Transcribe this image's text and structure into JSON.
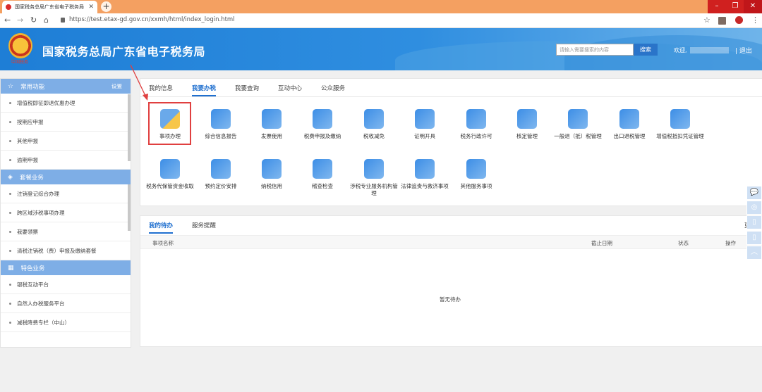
{
  "browser": {
    "tab_title": "国家税务总局广东省电子税务局",
    "url": "https://test.etax-gd.gov.cn/xxmh/html/index_login.html"
  },
  "header": {
    "title": "国家税务总局广东省电子税务局",
    "emblem_caption": "中国税务",
    "search_placeholder": "请输入需要搜索的内容",
    "search_button": "搜索",
    "welcome": "欢迎,",
    "logout": "| 退出"
  },
  "sidebar": {
    "sections": [
      {
        "title": "常用功能",
        "settings": "设置",
        "items": [
          "增值税即征即退优惠办理",
          "按期应申报",
          "其他申报",
          "逾期申报"
        ]
      },
      {
        "title": "套餐业务",
        "items": [
          "注销登记综合办理",
          "跨区域涉税事项办理",
          "我要领票",
          "清税注销税（费）申报及缴纳套餐"
        ]
      },
      {
        "title": "特色业务",
        "items": [
          "银税互动平台",
          "自然人办税服务平台",
          "减税降费专栏（中山）"
        ]
      }
    ]
  },
  "main_tabs": [
    "我的信息",
    "我要办税",
    "我要查询",
    "互动中心",
    "公众服务"
  ],
  "services": [
    {
      "label": "事项办理",
      "color": "#f7c64a"
    },
    {
      "label": "综合信息报告",
      "color": "#3d8ee6"
    },
    {
      "label": "发票使用",
      "color": "#3d8ee6"
    },
    {
      "label": "税费申报及缴纳",
      "color": "#3d8ee6"
    },
    {
      "label": "税收减免",
      "color": "#3d8ee6"
    },
    {
      "label": "证明开具",
      "color": "#3d8ee6"
    },
    {
      "label": "税务行政许可",
      "color": "#3d8ee6"
    },
    {
      "label": "核定管理",
      "color": "#3d8ee6"
    },
    {
      "label": "一般退（抵）税管理",
      "color": "#3d8ee6"
    },
    {
      "label": "出口退税管理",
      "color": "#3d8ee6"
    },
    {
      "label": "增值税抵扣凭证管理",
      "color": "#3d8ee6"
    },
    {
      "label": "税务代保管资金收取",
      "color": "#3d8ee6"
    },
    {
      "label": "预约定价安排",
      "color": "#3d8ee6"
    },
    {
      "label": "纳税信用",
      "color": "#3d8ee6"
    },
    {
      "label": "稽查检查",
      "color": "#3d8ee6"
    },
    {
      "label": "涉税专业服务机构管理",
      "color": "#3d8ee6"
    },
    {
      "label": "法律追责与救济事项",
      "color": "#3d8ee6"
    },
    {
      "label": "其他服务事项",
      "color": "#3d8ee6"
    }
  ],
  "todo": {
    "tabs": [
      "我的待办",
      "服务提醒"
    ],
    "more": "更多",
    "columns": [
      "事项名称",
      "截止日期",
      "状态",
      "操作"
    ],
    "empty": "暂无待办"
  },
  "colors": {
    "primary": "#1f6fcf",
    "sidebar_header": "#7eaee6",
    "highlight": "#e04040"
  }
}
